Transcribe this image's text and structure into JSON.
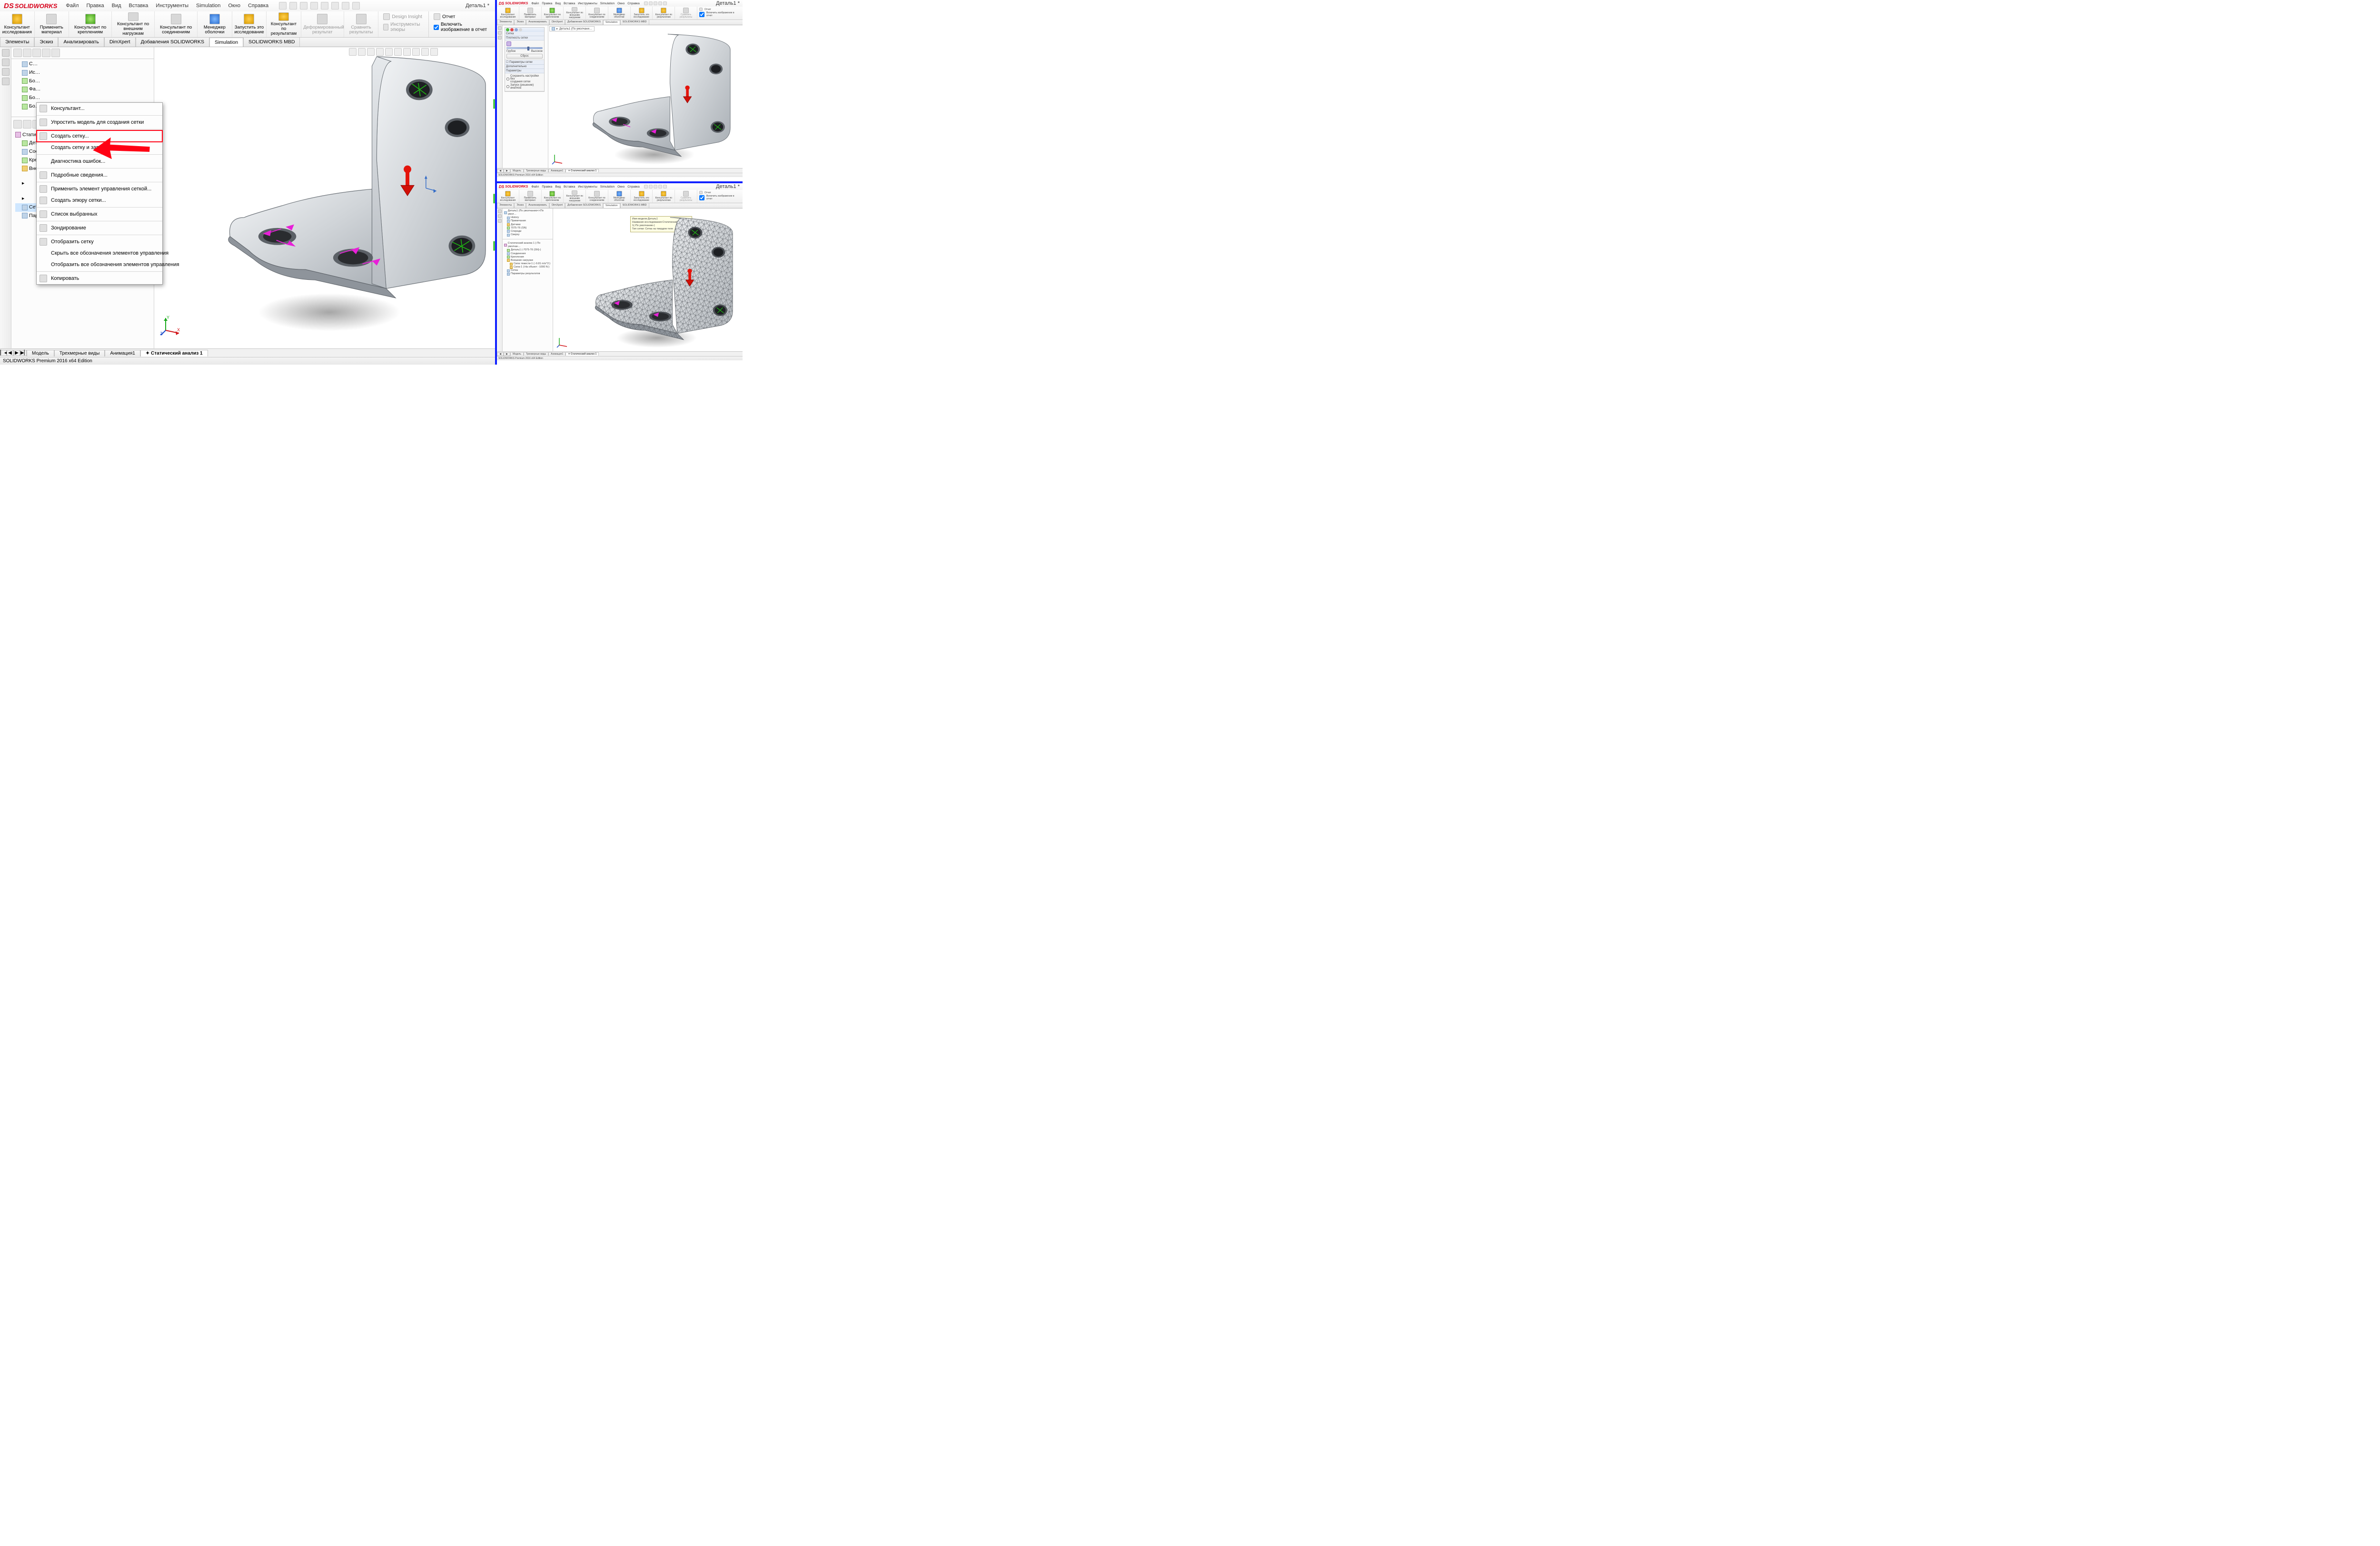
{
  "app": {
    "name": "SOLIDWORKS",
    "document": "Деталь1 *",
    "status": "SOLIDWORKS Premium 2016 x64 Edition"
  },
  "menus": [
    "Файл",
    "Правка",
    "Вид",
    "Вставка",
    "Инструменты",
    "Simulation",
    "Окно",
    "Справка"
  ],
  "ribbon": {
    "groups": [
      {
        "label": "Консультант\nисследования"
      },
      {
        "label": "Применить\nматериал"
      },
      {
        "label": "Консультант по\nкреплениям"
      },
      {
        "label": "Консультант по\nвнешним нагрузкам"
      },
      {
        "label": "Консультант по\nсоединениям"
      },
      {
        "label": "Менеджер\nоболочки"
      },
      {
        "label": "Запустить это\nисследование"
      },
      {
        "label": "Консультант по\nрезультатам"
      },
      {
        "label": "Деформированный\nрезультат",
        "disabled": true
      },
      {
        "label": "Сравнить\nрезультаты",
        "disabled": true
      },
      {
        "label": "Design Insight",
        "disabled": true
      },
      {
        "label": "Инструменты эпюры",
        "disabled": true
      }
    ],
    "report_label": "Отчет",
    "include_label": "Включить изображение в отчет"
  },
  "command_tabs": [
    "Элементы",
    "Эскиз",
    "Анализировать",
    "DimXpert",
    "Добавления SOLIDWORKS",
    "Simulation",
    "SOLIDWORKS MBD"
  ],
  "command_tabs_active": 5,
  "feature_tree": {
    "items": [
      "С…",
      "Ис…",
      "Бо…",
      "Фа…",
      "Бо…",
      "Бо…"
    ]
  },
  "study_tree": {
    "study": "Статиче…",
    "items": [
      "Дет…",
      "Сое…",
      "Кре…",
      "Вне…"
    ],
    "mesh_label": "Сетка",
    "results_label": "Параметры результатов"
  },
  "context_menu": {
    "items": [
      {
        "label": "Консультант...",
        "sep_after": true
      },
      {
        "label": "Упростить модель для создания сетки",
        "sep_after": true
      },
      {
        "label": "Создать сетку...",
        "highlight": true
      },
      {
        "label": "Создать сетку и запустить",
        "sep_after": true
      },
      {
        "label": "Диагностика ошибок...",
        "sep_after": true
      },
      {
        "label": "Подробные сведения...",
        "sep_after": true
      },
      {
        "label": "Применить элемент управления сеткой..."
      },
      {
        "label": "Создать эпюру сетки...",
        "sep_after": true
      },
      {
        "label": "Список выбранных",
        "sep_after": true
      },
      {
        "label": "Зондирование",
        "sep_after": true
      },
      {
        "label": "Отобразить сетку"
      },
      {
        "label": "Скрыть все обозначения элементов управления"
      },
      {
        "label": "Отобразить все обозначения элементов управления",
        "sep_after": true
      },
      {
        "label": "Копировать"
      }
    ]
  },
  "bottom_tabs": {
    "tabs": [
      "Модель",
      "Трехмерные виды",
      "Анимация1",
      "Статический анализ 1"
    ],
    "active": 3
  },
  "mini_top": {
    "flyout": "Деталь1 (По умолчани…",
    "pm": {
      "title": "Сетка",
      "density_title": "Плотность сетки",
      "coarse": "Грубое",
      "fine": "Высокое",
      "reset": "Сброс",
      "extra": "Дополнительно",
      "params": "Параметры сетки",
      "options_title": "Параметры",
      "opt1": "Сохранить настройки без\nсоздания сетки",
      "opt2": "Запуск (решение) анализа"
    },
    "bottom_tabs": [
      "Модель",
      "Трехмерные виды",
      "Анимация1",
      "Статический анализ 1"
    ]
  },
  "mini_bottom": {
    "callout": {
      "l1": "Имя модели:Деталь1",
      "l2": "Название исследования:Статический анализ 1(-По умолчанию-)",
      "l3": "Тип сетки: Сетка на твердом теле"
    },
    "fm": {
      "root": "Деталь1 (По умолчанию<<По умол…",
      "history": "History",
      "annot": "Примечания",
      "sensors": "Датчики",
      "material": "7075-T6 (SN)",
      "front": "Спереди",
      "top": "Сверху"
    },
    "study": {
      "name": "Статический анализ 1 (-По умолчан…",
      "part": "Деталь1 (-7075-T6 (SN)-)",
      "connectors": "Соединения",
      "fixtures": "Крепления",
      "loads": "Внешние нагрузки",
      "gravity": "Сила тяжести-1 (:-9.81 m/s^2:)",
      "force": "Сила-1 (:На объект: -1000 N:)",
      "mesh": "Сетка",
      "results": "Параметры результатов"
    },
    "bottom_tabs": [
      "Модель",
      "Трехмерные виды",
      "Анимация1",
      "Статический анализ 1"
    ]
  }
}
